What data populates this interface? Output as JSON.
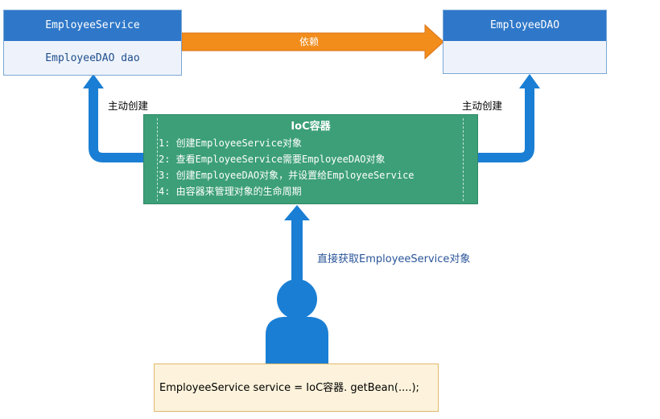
{
  "left_class": {
    "name": "EmployeeService",
    "field": "EmployeeDAO dao"
  },
  "right_class": {
    "name": "EmployeeDAO",
    "field": ""
  },
  "dependency_label": "依赖",
  "left_arrow_label": "主动创建",
  "right_arrow_label": "主动创建",
  "ioc": {
    "title": "IoC容器",
    "steps": [
      "1: 创建EmployeeService对象",
      "2: 查看EmployeeService需要EmployeeDAO对象",
      "3: 创建EmployeeDAO对象，并设置给EmployeeService",
      "4: 由容器来管理对象的生命周期"
    ]
  },
  "get_label": "直接获取EmployeeService对象",
  "code_line": "EmployeeService service  = IoC容器. getBean(....);",
  "colors": {
    "class_header": "#2f78c9",
    "ioc_container": "#3c9f78",
    "dependency_arrow": "#f28c1b",
    "flow_arrow": "#1a7fd4",
    "code_box": "#fdf3dc"
  }
}
